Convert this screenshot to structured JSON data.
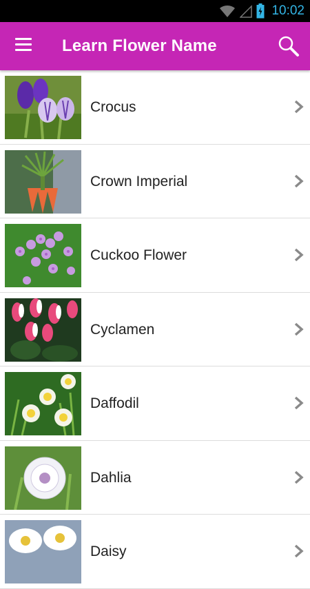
{
  "status_bar": {
    "time": "10:02"
  },
  "app_bar": {
    "title": "Learn Flower Name"
  },
  "flowers": [
    {
      "name": "Crocus"
    },
    {
      "name": "Crown Imperial"
    },
    {
      "name": "Cuckoo Flower"
    },
    {
      "name": "Cyclamen"
    },
    {
      "name": "Daffodil"
    },
    {
      "name": "Dahlia"
    },
    {
      "name": "Daisy"
    }
  ],
  "colors": {
    "app_bar": "#c526b5",
    "status_icons": "#33b5e5"
  }
}
